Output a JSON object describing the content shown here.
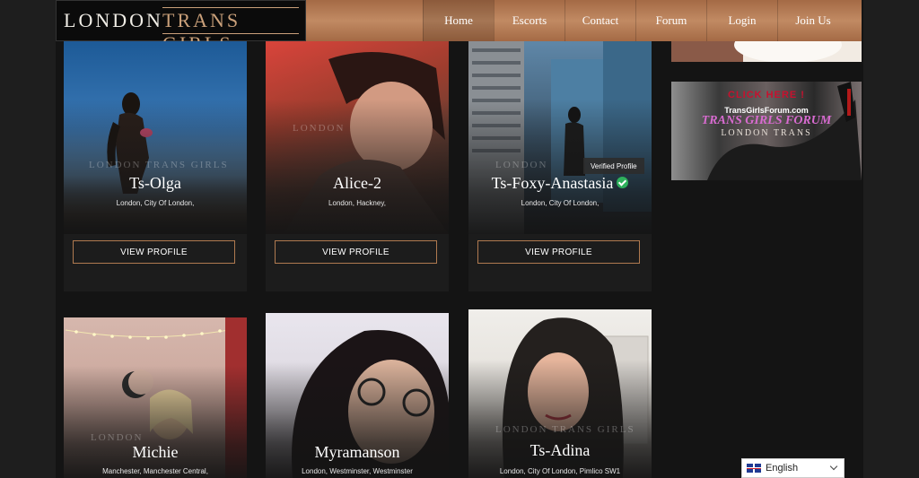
{
  "header": {
    "logo": {
      "word1": "LONDON",
      "word2": "TRANS GIRLS"
    },
    "nav": [
      {
        "label": "Home",
        "active": true
      },
      {
        "label": "Escorts"
      },
      {
        "label": "Contact"
      },
      {
        "label": "Forum"
      },
      {
        "label": "Login"
      },
      {
        "label": "Join Us"
      }
    ]
  },
  "cards": [
    {
      "name": "Ts-Olga",
      "location": "London, City Of London,",
      "button": "VIEW PROFILE",
      "watermark": "LONDON TRANS GIRLS"
    },
    {
      "name": "Alice-2",
      "location": "London, Hackney,",
      "button": "VIEW PROFILE",
      "watermark": "LONDON"
    },
    {
      "name": "Ts-Foxy-Anastasia",
      "location": "London, City Of London,",
      "button": "VIEW PROFILE",
      "watermark": "LONDON",
      "badge": "Verified Profile"
    },
    {
      "name": "Michie",
      "location": "Manchester, Manchester Central,",
      "watermark": "LONDON"
    },
    {
      "name": "Myramanson",
      "location": "London, Westminster, Westminster"
    },
    {
      "name": "Ts-Adina",
      "location": "London, City Of London, Pimlico SW1",
      "watermark": "LONDON TRANS GIRLS"
    }
  ],
  "sidebar": {
    "ad_banner": {
      "line1": "CLICK HERE !",
      "line2": "TransGirlsForum.com",
      "line3": "TRANS GIRLS FORUM",
      "line4": "LONDON TRANS"
    }
  },
  "language": {
    "selected": "English"
  },
  "colors": {
    "accent": "#b07a50",
    "header_gradient": "#a46a45",
    "page_bg": "#141414",
    "verified": "#2eb05c"
  }
}
